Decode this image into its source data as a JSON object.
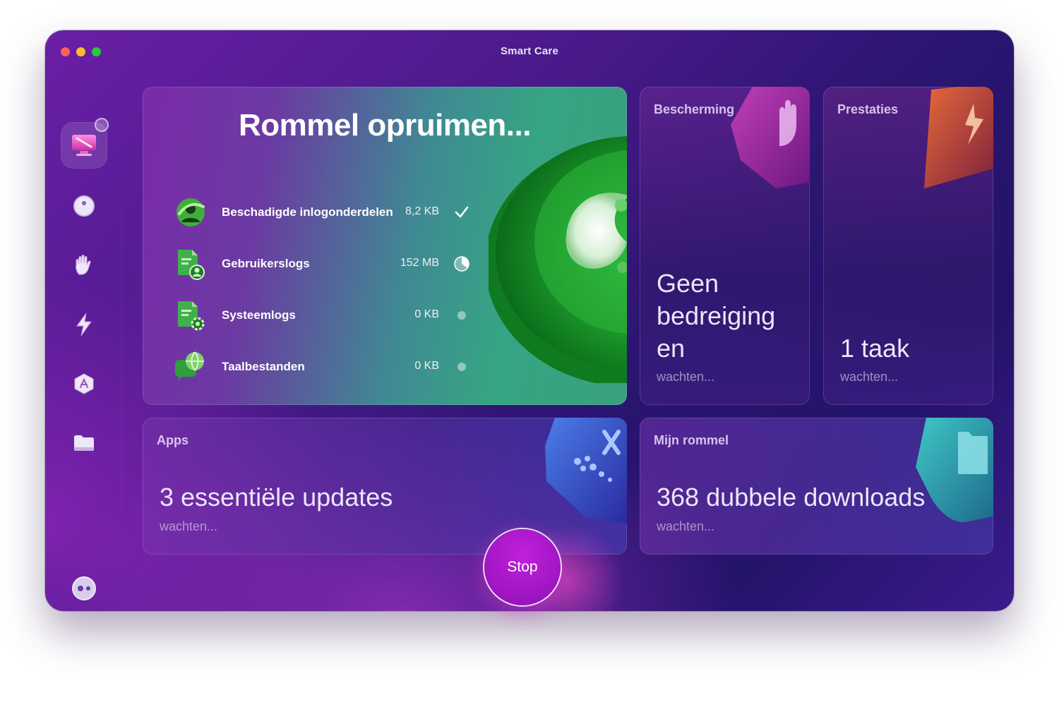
{
  "window": {
    "title": "Smart Care"
  },
  "sidebar": {
    "items": [
      {
        "icon": "monitor-cleanup-icon",
        "active": true
      },
      {
        "icon": "protection-disc-icon"
      },
      {
        "icon": "hand-icon"
      },
      {
        "icon": "lightning-icon"
      },
      {
        "icon": "applications-icon"
      },
      {
        "icon": "folder-icon"
      }
    ],
    "bottom_icon": "assistant-icon"
  },
  "cleanup": {
    "title": "Rommel opruimen...",
    "rows": [
      {
        "label": "Beschadigde inlogonderdelen",
        "size": "8,2 KB",
        "status": "done",
        "icon": "broken-login-items-icon"
      },
      {
        "label": "Gebruikerslogs",
        "size": "152 MB",
        "status": "in-progress",
        "progress": 0.35,
        "icon": "user-logs-icon"
      },
      {
        "label": "Systeemlogs",
        "size": "0 KB",
        "status": "pending",
        "icon": "system-logs-icon"
      },
      {
        "label": "Taalbestanden",
        "size": "0 KB",
        "status": "pending",
        "icon": "language-files-icon"
      }
    ]
  },
  "protection": {
    "label": "Bescherming",
    "value": "Geen bedreiging en",
    "status": "wachten..."
  },
  "performance": {
    "label": "Prestaties",
    "value": "1 taak",
    "status": "wachten..."
  },
  "apps": {
    "label": "Apps",
    "value": "3 essentiële updates",
    "status": "wachten..."
  },
  "my_clutter": {
    "label": "Mijn rommel",
    "value": "368 dubbele downloads",
    "status": "wachten..."
  },
  "stop_button": {
    "label": "Stop"
  },
  "colors": {
    "accent": "#a316c6",
    "cleanup_green": "#3aa07e",
    "window_bg": "#2a1570"
  }
}
